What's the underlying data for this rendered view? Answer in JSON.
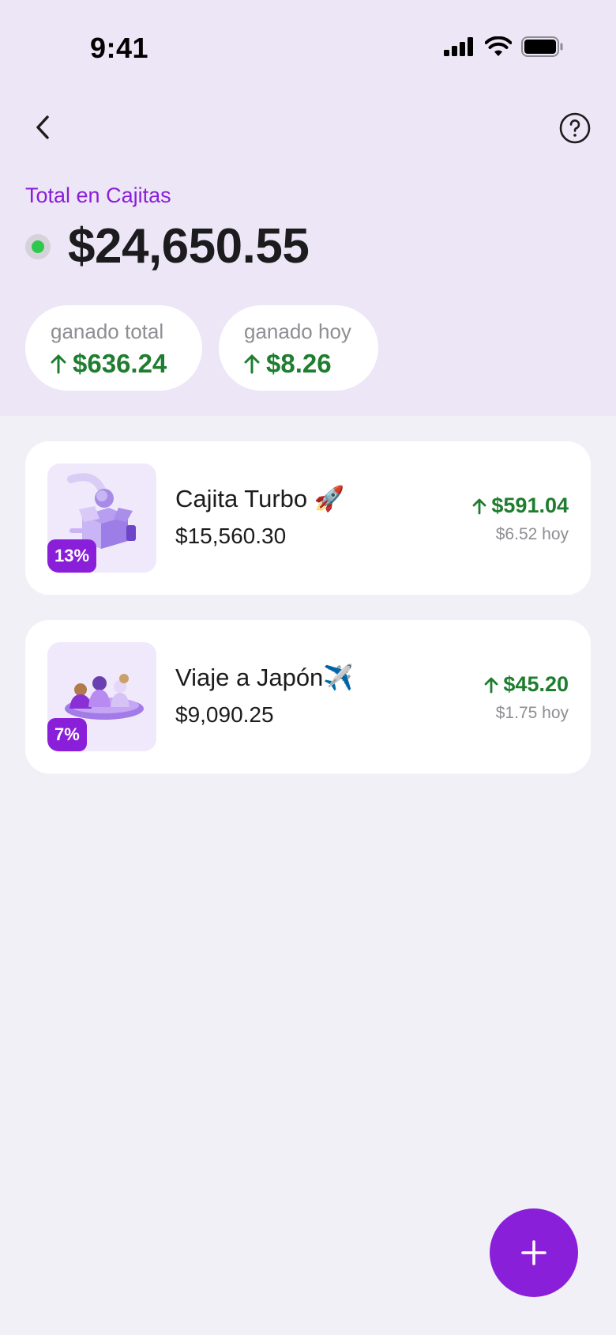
{
  "status_bar": {
    "time": "9:41"
  },
  "nav": {
    "back_icon": "chevron-left-icon",
    "help_icon": "question-circle-icon"
  },
  "summary": {
    "label": "Total en Cajitas",
    "amount": "$24,650.55",
    "status_color": "#2fc84e"
  },
  "stats": [
    {
      "label": "ganado total",
      "value": "$636.24"
    },
    {
      "label": "ganado hoy",
      "value": "$8.26"
    }
  ],
  "cajitas": [
    {
      "name": "Cajita Turbo 🚀",
      "balance": "$15,560.30",
      "rate": "13%",
      "gain": "$591.04",
      "today": "$6.52 hoy"
    },
    {
      "name": "Viaje a Japón✈️",
      "balance": "$9,090.25",
      "rate": "7%",
      "gain": "$45.20",
      "today": "$1.75 hoy"
    }
  ],
  "colors": {
    "accent": "#8a1fd9",
    "positive": "#1e7d2e",
    "header_bg": "#ede6f6"
  }
}
